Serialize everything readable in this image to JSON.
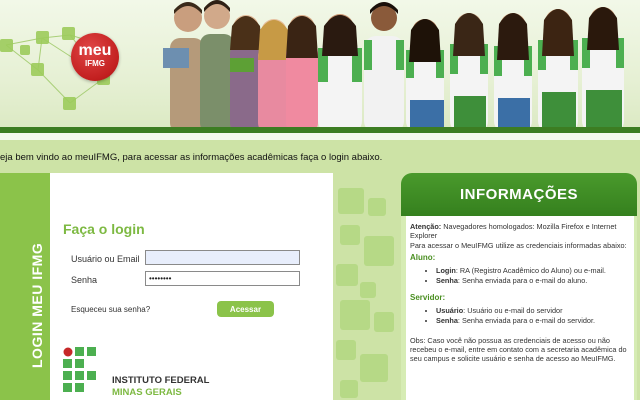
{
  "header": {
    "logo_line1": "meu",
    "logo_line2": "IFMG"
  },
  "welcome_text": "eja bem vindo ao meuIFMG, para acessar as informações acadêmicas faça o login abaixo.",
  "login": {
    "side_label": "LOGIN MEU IFMG",
    "title": "Faça o login",
    "user_label": "Usuário ou Email",
    "user_value": "",
    "password_label": "Senha",
    "password_value": "••••••••",
    "forgot_label": "Esqueceu sua senha?",
    "submit_label": "Acessar"
  },
  "institution": {
    "line1": "INSTITUTO FEDERAL",
    "line2": "MINAS GERAIS"
  },
  "info": {
    "title": "INFORMAÇÕES",
    "attention_bold": "Atenção:",
    "attention_text": " Navegadores homologados: Mozilla Firefox e Internet Explorer",
    "credentials_text": "Para acessar o MeuIFMG utilize as credenciais informadas abaixo:",
    "student_heading": "Aluno:",
    "student_items": [
      {
        "bold": "Login",
        "text": ": RA (Registro Acadêmico do Aluno) ou e-mail."
      },
      {
        "bold": "Senha",
        "text": ": Senha enviada para o e-mail do aluno."
      }
    ],
    "staff_heading": "Servidor:",
    "staff_items": [
      {
        "bold": "Usuário",
        "text": ": Usuário ou e-mail do servidor"
      },
      {
        "bold": "Senha",
        "text": ": Senha enviada para o e-mail do servidor."
      }
    ],
    "note": "Obs: Caso você não possua as credenciais de acesso ou não recebeu o e-mail, entre em contato com a secretaria acadêmica do seu campus e solicite usuário e senha de acesso ao MeuIFMG."
  },
  "colors": {
    "brand_green": "#3c7d22",
    "accent_green": "#8bc34a",
    "logo_red": "#c21f1f"
  }
}
